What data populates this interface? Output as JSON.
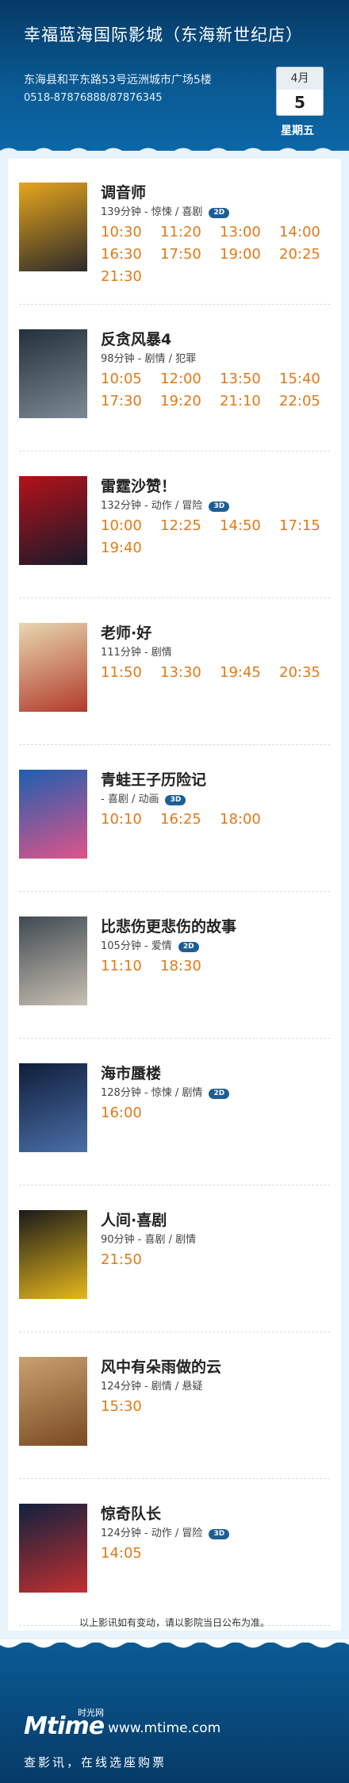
{
  "header": {
    "cinema_name": "幸福蓝海国际影城（东海新世纪店）",
    "address": "东海县和平东路53号远洲城市广场5楼",
    "phone": "0518-87876888/87876345",
    "date": {
      "month": "4月",
      "day": "5",
      "weekday": "星期五"
    }
  },
  "movies": [
    {
      "title": "调音师",
      "info": "139分钟 - 惊悚 / 喜剧",
      "format": "2D",
      "poster_colors": [
        "#e6a51c",
        "#2c2a2a"
      ],
      "showtimes": [
        "10:30",
        "11:20",
        "13:00",
        "14:00",
        "16:30",
        "17:50",
        "19:00",
        "20:25",
        "21:30"
      ]
    },
    {
      "title": "反贪风暴4",
      "info": "98分钟 - 剧情 / 犯罪",
      "format": "",
      "poster_colors": [
        "#24303c",
        "#7d8a95"
      ],
      "showtimes": [
        "10:05",
        "12:00",
        "13:50",
        "15:40",
        "17:30",
        "19:20",
        "21:10",
        "22:05"
      ]
    },
    {
      "title": "雷霆沙赞！",
      "info": "132分钟 - 动作 / 冒险",
      "format": "3D",
      "poster_colors": [
        "#b3121a",
        "#1a1a2a"
      ],
      "showtimes": [
        "10:00",
        "12:25",
        "14:50",
        "17:15",
        "19:40"
      ]
    },
    {
      "title": "老师·好",
      "info": "111分钟 - 剧情",
      "format": "",
      "poster_colors": [
        "#e8d7b0",
        "#b23a2a"
      ],
      "showtimes": [
        "11:50",
        "13:30",
        "19:45",
        "20:35"
      ]
    },
    {
      "title": "青蛙王子历险记",
      "info": "- 喜剧 / 动画",
      "format": "3D",
      "poster_colors": [
        "#1d5fb0",
        "#e0548a"
      ],
      "showtimes": [
        "10:10",
        "16:25",
        "18:00"
      ]
    },
    {
      "title": "比悲伤更悲伤的故事",
      "info": "105分钟 - 爱情",
      "format": "2D",
      "poster_colors": [
        "#3f4a52",
        "#c9c0b2"
      ],
      "showtimes": [
        "11:10",
        "18:30"
      ]
    },
    {
      "title": "海市蜃楼",
      "info": "128分钟 - 惊悚 / 剧情",
      "format": "2D",
      "poster_colors": [
        "#0f1e3a",
        "#4b6fa8"
      ],
      "showtimes": [
        "16:00"
      ]
    },
    {
      "title": "人间·喜剧",
      "info": "90分钟 - 喜剧 / 剧情",
      "format": "",
      "poster_colors": [
        "#1a1a1a",
        "#e6b81c"
      ],
      "showtimes": [
        "21:50"
      ]
    },
    {
      "title": "风中有朵雨做的云",
      "info": "124分钟 - 剧情 / 悬疑",
      "format": "",
      "poster_colors": [
        "#c9a070",
        "#7a4a22"
      ],
      "showtimes": [
        "15:30"
      ]
    },
    {
      "title": "惊奇队长",
      "info": "124分钟 - 动作 / 冒险",
      "format": "3D",
      "poster_colors": [
        "#10213f",
        "#c23030"
      ],
      "showtimes": [
        "14:05"
      ]
    }
  ],
  "notice": "以上影讯如有变动，请以影院当日公布为准。",
  "footer": {
    "logo_text": "Mtime",
    "logo_sub": "时光网",
    "website": "www.mtime.com",
    "slogan": "查影讯，在线选座购票"
  },
  "colors": {
    "header_blue": "#0a5b95",
    "time_orange": "#e07a18",
    "panel_blue": "#e8f3fb"
  }
}
